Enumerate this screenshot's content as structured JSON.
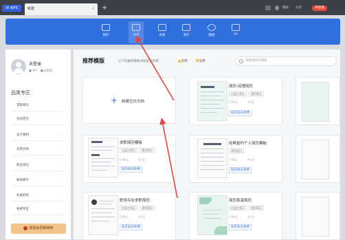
{
  "titlebar": {
    "logo": "W WPS",
    "tab_label": "新建",
    "tab_close": "×",
    "new_tab": "+",
    "items": [
      "模板",
      "分享"
    ],
    "vip_button": "未登录"
  },
  "header": {
    "buttons": [
      "我的",
      "文字",
      "表格",
      "演示",
      "脑图",
      "H5"
    ],
    "selected": "文字"
  },
  "user": {
    "name": "未登录",
    "status": "● KIT、●以会员"
  },
  "categories": {
    "title": "品类专区",
    "items": [
      "求职简历",
      "合同范文",
      "设计素材",
      "实用文档",
      "职业岗位",
      "教育教学",
      "权威机构",
      "免费专区"
    ],
    "vip_button": "体验会员新特权"
  },
  "main": {
    "section_title": "推荐模版",
    "hint": "以下的推荐模板对你是否有用：",
    "useful_yes": "有用",
    "useful_no": "没用",
    "search_placeholder": "搜索推荐的模板",
    "blank_doc": "新建空白文档"
  },
  "cards": [
    {
      "title": "简历-经理简历",
      "tags": [
        "应届生简历",
        "通用简历"
      ],
      "price": "0.99元",
      "count": "共1页",
      "button": "稻壳会员免费"
    },
    {
      "title": "求职简历模板",
      "tags": [
        "应届生简历",
        "通用简历"
      ],
      "price": "0.99元",
      "count": "共1页",
      "button": "稻壳会员免费"
    },
    {
      "title": "经典复约个人简历模板",
      "tags": [
        "通用简历"
      ],
      "price": "7.99元",
      "count": "共1页",
      "button": "稻壳会员免费"
    },
    {
      "title": "职场专业求职简历",
      "tags": [
        "应届生简历",
        "通用简历"
      ],
      "price": "0.99元",
      "count": "共1页",
      "button": "稻壳会员免费"
    },
    {
      "title": "简历表演简历",
      "tags": [
        "应届生简历",
        "通用简历"
      ],
      "price": "0.99元",
      "count": "共1页",
      "button": "稻壳会员免费"
    }
  ],
  "colors": {
    "brand_blue": "#2f6fde",
    "arrow_red": "#e0463b",
    "titlebar": "#3d4047"
  }
}
